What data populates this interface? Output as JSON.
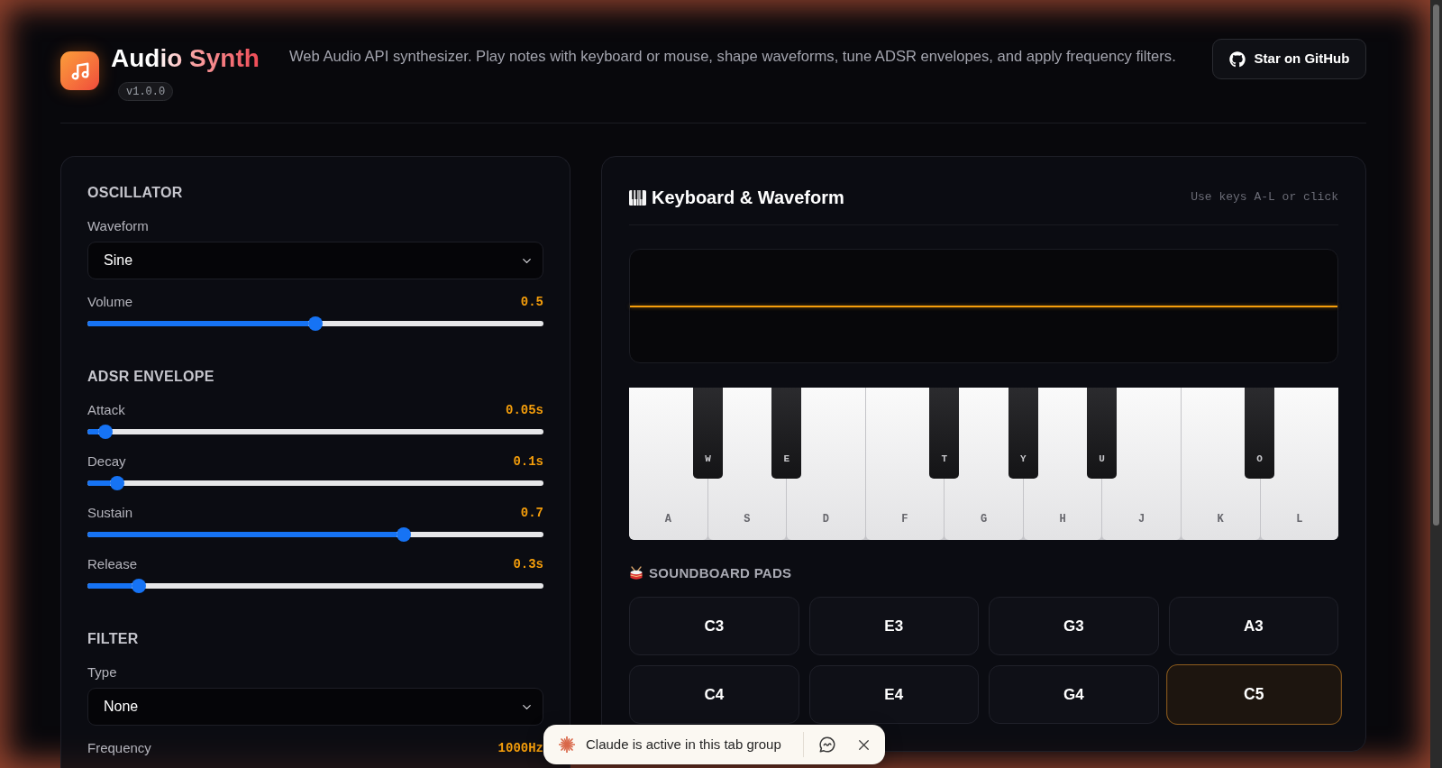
{
  "header": {
    "title": "Audio Synth",
    "version": "v1.0.0",
    "description": "Web Audio API synthesizer. Play notes with keyboard or mouse, shape waveforms, tune ADSR envelopes, and apply frequency filters.",
    "github_button": "Star on GitHub"
  },
  "controls": [
    {
      "title": "OSCILLATOR",
      "items": [
        {
          "kind": "select",
          "label": "Waveform",
          "value": "Sine"
        },
        {
          "kind": "slider",
          "label": "Volume",
          "reading": "0.5",
          "level": 0.5
        }
      ]
    },
    {
      "title": "ADSR ENVELOPE",
      "items": [
        {
          "kind": "slider",
          "label": "Attack",
          "reading": "0.05s",
          "level": 0.025
        },
        {
          "kind": "slider",
          "label": "Decay",
          "reading": "0.1s",
          "level": 0.05
        },
        {
          "kind": "slider",
          "label": "Sustain",
          "reading": "0.7",
          "level": 0.7
        },
        {
          "kind": "slider",
          "label": "Release",
          "reading": "0.3s",
          "level": 0.1
        }
      ]
    },
    {
      "title": "FILTER",
      "items": [
        {
          "kind": "select",
          "label": "Type",
          "value": "None"
        },
        {
          "kind": "slider",
          "label": "Frequency",
          "reading": "1000Hz"
        }
      ]
    }
  ],
  "keyboard": {
    "title": "Keyboard & Waveform",
    "hint": "Use keys A-L or click",
    "keys": [
      {
        "kind": "white",
        "label": "A"
      },
      {
        "kind": "black",
        "label": "W"
      },
      {
        "kind": "white",
        "label": "S"
      },
      {
        "kind": "black",
        "label": "E"
      },
      {
        "kind": "white",
        "label": "D"
      },
      {
        "kind": "white",
        "label": "F"
      },
      {
        "kind": "black",
        "label": "T"
      },
      {
        "kind": "white",
        "label": "G"
      },
      {
        "kind": "black",
        "label": "Y"
      },
      {
        "kind": "white",
        "label": "H"
      },
      {
        "kind": "black",
        "label": "U"
      },
      {
        "kind": "white",
        "label": "J"
      },
      {
        "kind": "white",
        "label": "K"
      },
      {
        "kind": "black",
        "label": "O"
      },
      {
        "kind": "white",
        "label": "L"
      }
    ]
  },
  "soundboard": {
    "title": "SOUNDBOARD PADS",
    "pads": [
      {
        "label": "C3",
        "active": false
      },
      {
        "label": "E3",
        "active": false
      },
      {
        "label": "G3",
        "active": false
      },
      {
        "label": "A3",
        "active": false
      },
      {
        "label": "C4",
        "active": false
      },
      {
        "label": "E4",
        "active": false
      },
      {
        "label": "G4",
        "active": false
      },
      {
        "label": "C5",
        "active": true
      }
    ]
  },
  "notification": {
    "message": "Claude is active in this tab group"
  }
}
